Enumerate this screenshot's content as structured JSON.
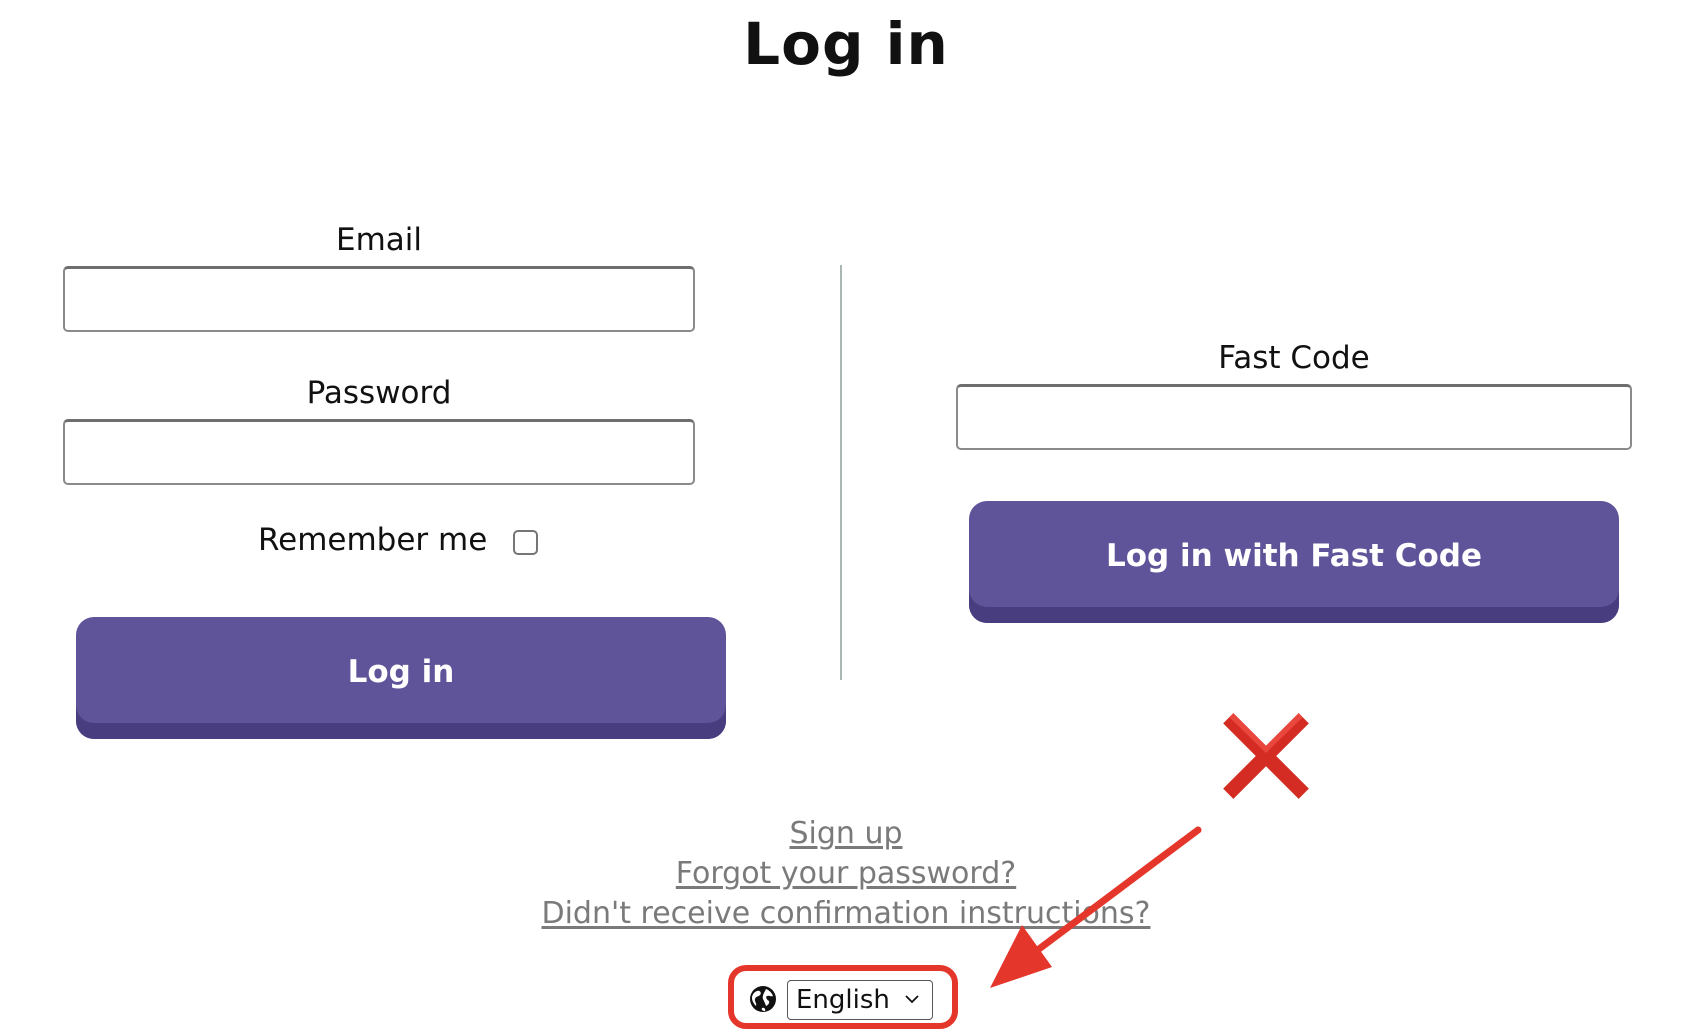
{
  "page": {
    "title": "Log in"
  },
  "login_form": {
    "email_label": "Email",
    "email_value": "",
    "password_label": "Password",
    "password_value": "",
    "remember_label": "Remember me",
    "remember_checked": false,
    "submit_label": "Log in"
  },
  "fast_code": {
    "label": "Fast Code",
    "value": "",
    "submit_label": "Log in with Fast Code"
  },
  "links": {
    "sign_up": "Sign up",
    "forgot_password": "Forgot your password?",
    "confirmation": "Didn't receive confirmation instructions?"
  },
  "language": {
    "icon": "globe-icon",
    "selected": "English"
  },
  "annotations": {
    "cross_icon": "cross-mark-icon",
    "arrow_icon": "arrow-icon",
    "highlight_color": "#e4362a"
  },
  "colors": {
    "button": "#5f5399",
    "button_shadow": "#483d7f",
    "link": "#7a7a7a",
    "divider": "#a9b6b4"
  }
}
